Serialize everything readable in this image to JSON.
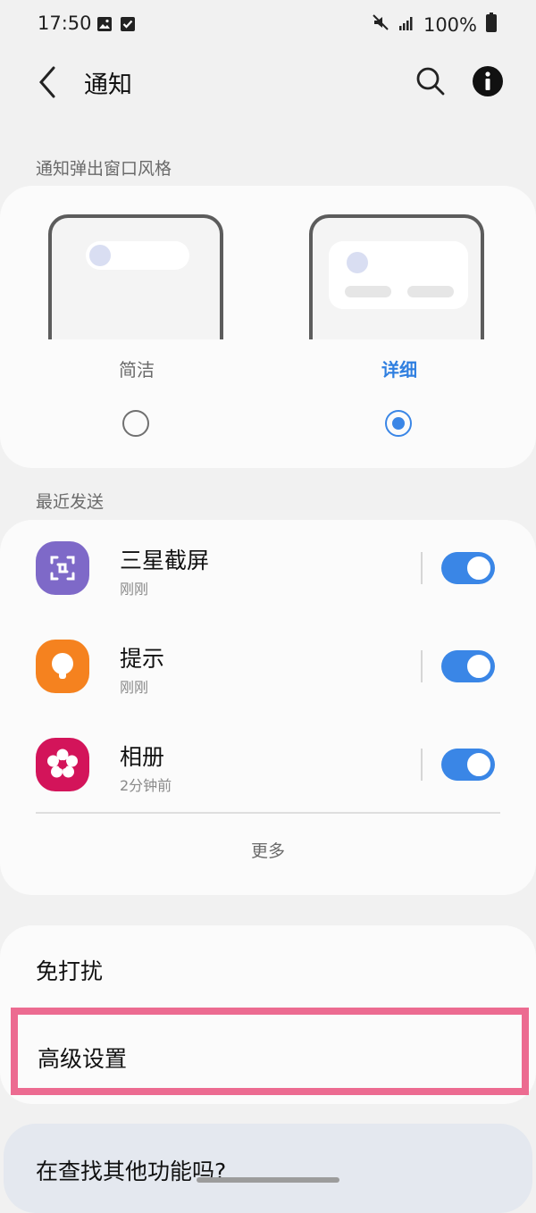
{
  "status_bar": {
    "time": "17:50",
    "battery": "100%"
  },
  "header": {
    "title": "通知"
  },
  "popup_style": {
    "section_label": "通知弹出窗口风格",
    "options": [
      {
        "label": "简洁",
        "selected": false
      },
      {
        "label": "详细",
        "selected": true
      }
    ]
  },
  "recent": {
    "section_label": "最近发送",
    "apps": [
      {
        "name": "三星截屏",
        "time": "刚刚",
        "enabled": true,
        "icon": "screenshot-icon"
      },
      {
        "name": "提示",
        "time": "刚刚",
        "enabled": true,
        "icon": "tips-bulb-icon"
      },
      {
        "name": "相册",
        "time": "2分钟前",
        "enabled": true,
        "icon": "gallery-flower-icon"
      }
    ],
    "more_label": "更多"
  },
  "settings": {
    "do_not_disturb": "免打扰",
    "advanced": "高级设置"
  },
  "suggestion": {
    "text": "在查找其他功能吗?"
  },
  "colors": {
    "accent": "#3a86e6",
    "highlight": "#ec6b91"
  }
}
